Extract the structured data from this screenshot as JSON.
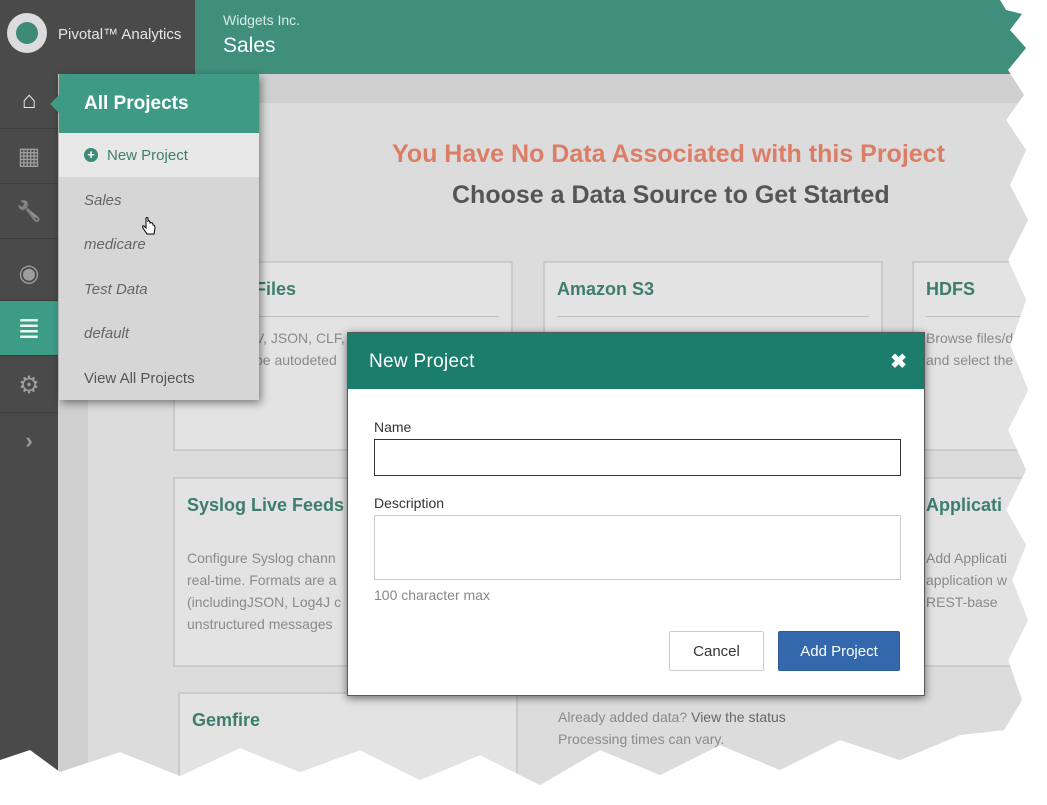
{
  "app": {
    "brand": "Pivotal™ Analytics"
  },
  "header": {
    "company": "Widgets Inc.",
    "title": "Sales"
  },
  "sidebar": {
    "items": [
      {
        "name": "home",
        "icon": "home-icon",
        "glyph": "⌂"
      },
      {
        "name": "apps",
        "icon": "grid-icon",
        "glyph": "▦"
      },
      {
        "name": "tools",
        "icon": "wrench-icon",
        "glyph": "🔧"
      },
      {
        "name": "view",
        "icon": "eye-icon",
        "glyph": "◉"
      },
      {
        "name": "data",
        "icon": "database-icon",
        "glyph": "≣"
      },
      {
        "name": "settings",
        "icon": "gear-icon",
        "glyph": "⚙"
      },
      {
        "name": "expand",
        "icon": "chevron-right-icon",
        "glyph": "›"
      }
    ]
  },
  "dropdown": {
    "title": "All Projects",
    "new_project": "New Project",
    "projects": [
      "Sales",
      "medicare",
      "Test Data",
      "default"
    ],
    "view_all": "View All Projects"
  },
  "main": {
    "headline": "You Have No Data Associated with this Project",
    "subheadline": "Choose a Data Source to Get Started",
    "cards": [
      {
        "title": "Files",
        "text": "V, JSON, CLF,\nbe autodeted"
      },
      {
        "title": "Amazon S3",
        "text": ""
      },
      {
        "title": "HDFS",
        "text": "Browse files/d\nand select the"
      },
      {
        "title": "Syslog Live Feeds",
        "text": "Configure Syslog chann\nreal-time. Formats are a\n(includingJSON, Log4J c\nunstructured messages"
      },
      {
        "title": "Applicati",
        "text": "Add Applicati\napplication w\nREST-base"
      },
      {
        "title": "Gemfire",
        "text": ""
      }
    ],
    "status_prefix": "Already added data? ",
    "status_link": "View the status",
    "status_note": "Processing times can vary."
  },
  "modal": {
    "title": "New Project",
    "close_glyph": "✖",
    "name_label": "Name",
    "name_value": "",
    "description_label": "Description",
    "description_value": "",
    "char_hint": "100 character max",
    "cancel_label": "Cancel",
    "submit_label": "Add Project"
  },
  "colors": {
    "accent": "#3f8f7c",
    "modal_header": "#1b7d6b",
    "primary_button": "#3368ad",
    "headline": "#dc7d66"
  }
}
